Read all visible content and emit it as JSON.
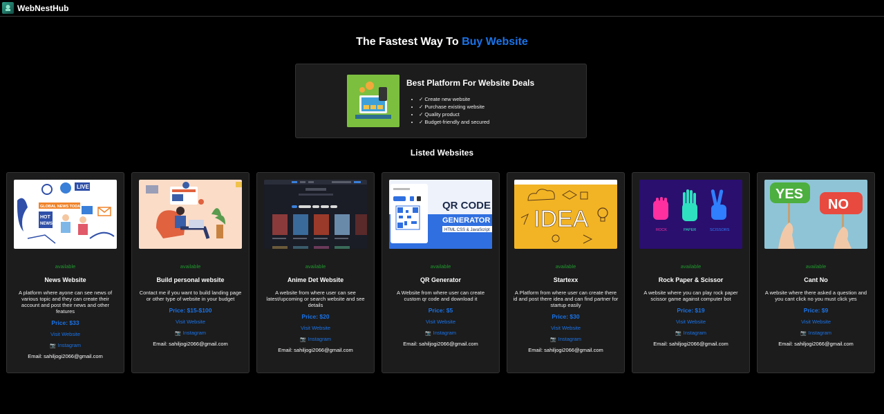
{
  "app": {
    "brand": "WebNestHub"
  },
  "hero": {
    "title_prefix": "The Fastest Way To",
    "title_accent": "Buy Website"
  },
  "promo": {
    "title": "Best Platform For Website Deals",
    "features": [
      "✓ Create new website",
      "✓ Purchase existing website",
      "✓ Quality product",
      "✓ Budget-friendly and secured"
    ]
  },
  "section_title": "Listed Websites",
  "cards": [
    {
      "status": "available",
      "title": "News Website",
      "description": "A platform where ayone can see news of various topic and they can create their account and post their news and other features",
      "price": "Price: $33",
      "visit": "Visit Website",
      "instagram": "Instagram",
      "email": "Email: sahiljogi2066@gmail.com"
    },
    {
      "status": "available",
      "title": "Build personal website",
      "description": "Contact me if you want to build landing page or other type of website in your budget",
      "price": "Price: $15-$100",
      "visit": "Visit Website",
      "instagram": "Instagram",
      "email": "Email: sahiljogi2066@gmail.com"
    },
    {
      "status": "available",
      "title": "Anime Det Website",
      "description": "A website from where user can see latest/upcoming or search website and see details",
      "price": "Price: $20",
      "visit": "Visit Website",
      "instagram": "Instagram",
      "email": "Email: sahiljogi2066@gmail.com"
    },
    {
      "status": "available",
      "title": "QR Generator",
      "description": "A Website from where user can create custom qr code and download it",
      "price": "Price: $5",
      "visit": "Visit Website",
      "instagram": "Instagram",
      "email": "Email: sahiljogi2066@gmail.com"
    },
    {
      "status": "available",
      "title": "Startexx",
      "description": "A Platform from where user can create there id and post there idea and can find partner for startup easily",
      "price": "Price: $30",
      "visit": "Visit Website",
      "instagram": "Instagram",
      "email": "Email: sahiljogi2066@gmail.com"
    },
    {
      "status": "available",
      "title": "Rock Paper & Scissor",
      "description": "A website where you can play rock paper scissor game against computer bot",
      "price": "Price: $19",
      "visit": "Visit Website",
      "instagram": "Instagram",
      "email": "Email: sahiljogi2066@gmail.com"
    },
    {
      "status": "available",
      "title": "Cant No",
      "description": "A website where there asked a question and you cant click no you must click yes",
      "price": "Price: $9",
      "visit": "Visit Website",
      "instagram": "Instagram",
      "email": "Email: sahiljogi2066@gmail.com"
    }
  ],
  "thumb_text": {
    "news": {
      "live": "LIVE",
      "global": "GLOBAL NEWS TODAY",
      "hot": "HOT",
      "news": "NEWS"
    },
    "qr": {
      "line1": "QR CODE",
      "line2": "GENERATOR",
      "line3": "HTML CSS & JavaScript"
    },
    "idea": {
      "word": "IDEA"
    },
    "rps": {
      "rock": "ROCK",
      "paper": "PAPER",
      "scissors": "SCISSORS"
    },
    "cantno": {
      "yes": "YES",
      "no": "NO"
    }
  },
  "colors": {
    "accent": "#1a73e8",
    "available": "#1f9a2d",
    "card_bg": "#1c1c1c",
    "page_bg": "#000000"
  }
}
